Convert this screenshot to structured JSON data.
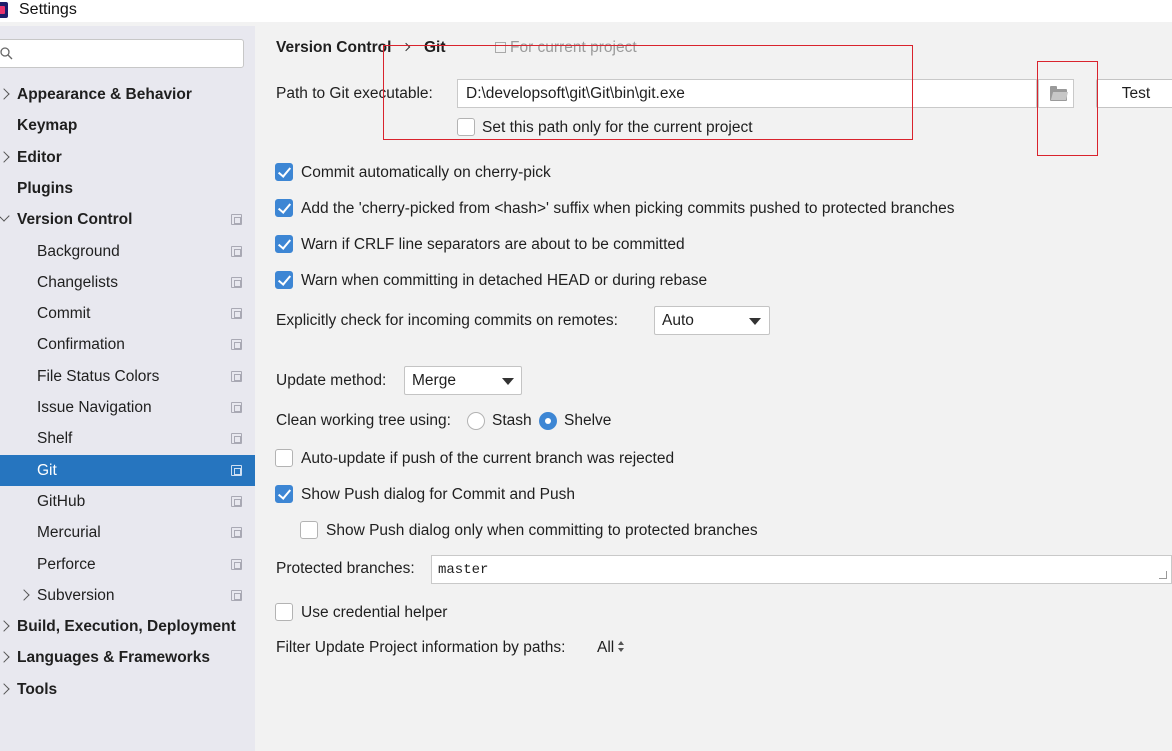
{
  "window": {
    "title": "Settings"
  },
  "sidebar": {
    "search": {
      "placeholder": "",
      "value": ""
    },
    "items": [
      {
        "label": "Appearance & Behavior",
        "bold": true,
        "expander": "right",
        "indent": 0
      },
      {
        "label": "Keymap",
        "bold": true,
        "expander": "none",
        "indent": 0
      },
      {
        "label": "Editor",
        "bold": true,
        "expander": "right",
        "indent": 0
      },
      {
        "label": "Plugins",
        "bold": true,
        "expander": "none",
        "indent": 0
      },
      {
        "label": "Version Control",
        "bold": true,
        "expander": "down",
        "indent": 0,
        "project_icon": true
      },
      {
        "label": "Background",
        "indent": 1,
        "project_icon": true
      },
      {
        "label": "Changelists",
        "indent": 1,
        "project_icon": true
      },
      {
        "label": "Commit",
        "indent": 1,
        "project_icon": true
      },
      {
        "label": "Confirmation",
        "indent": 1,
        "project_icon": true
      },
      {
        "label": "File Status Colors",
        "indent": 1,
        "project_icon": true
      },
      {
        "label": "Issue Navigation",
        "indent": 1,
        "project_icon": true
      },
      {
        "label": "Shelf",
        "indent": 1,
        "project_icon": true
      },
      {
        "label": "Git",
        "indent": 1,
        "project_icon": true,
        "selected": true
      },
      {
        "label": "GitHub",
        "indent": 1,
        "project_icon": true
      },
      {
        "label": "Mercurial",
        "indent": 1,
        "project_icon": true
      },
      {
        "label": "Perforce",
        "indent": 1,
        "project_icon": true
      },
      {
        "label": "Subversion",
        "indent": 1,
        "expander": "right",
        "project_icon": true
      },
      {
        "label": "Build, Execution, Deployment",
        "bold": true,
        "expander": "right",
        "indent": 0
      },
      {
        "label": "Languages & Frameworks",
        "bold": true,
        "expander": "right",
        "indent": 0
      },
      {
        "label": "Tools",
        "bold": true,
        "expander": "right",
        "indent": 0
      }
    ]
  },
  "breadcrumb": {
    "parent": "Version Control",
    "current": "Git",
    "scope": "For current project"
  },
  "git": {
    "path_label": "Path to Git executable:",
    "path_value": "D:\\developsoft\\git\\Git\\bin\\git.exe",
    "test_label": "Test",
    "path_only_current": {
      "label": "Set this path only for the current project",
      "checked": false
    },
    "options": [
      {
        "label": "Commit automatically on cherry-pick",
        "checked": true
      },
      {
        "label": "Add the 'cherry-picked from <hash>' suffix when picking commits pushed to protected branches",
        "checked": true
      },
      {
        "label": "Warn if CRLF line separators are about to be committed",
        "checked": true
      },
      {
        "label": "Warn when committing in detached HEAD or during rebase",
        "checked": true
      }
    ],
    "incoming_label": "Explicitly check for incoming commits on remotes:",
    "incoming_value": "Auto",
    "update_method_label": "Update method:",
    "update_method_value": "Merge",
    "clean_tree_label": "Clean working tree using:",
    "clean_tree_options": [
      {
        "label": "Stash",
        "checked": false
      },
      {
        "label": "Shelve",
        "checked": true
      }
    ],
    "auto_update": {
      "label": "Auto-update if push of the current branch was rejected",
      "checked": false
    },
    "show_push": {
      "label": "Show Push dialog for Commit and Push",
      "checked": true
    },
    "show_push_protected": {
      "label": "Show Push dialog only when committing to protected branches",
      "checked": false
    },
    "protected_label": "Protected branches:",
    "protected_value": "master",
    "credential_helper": {
      "label": "Use credential helper",
      "checked": false
    },
    "filter_label": "Filter Update Project information by paths:",
    "filter_value": "All"
  },
  "colors": {
    "selection": "#2675bf",
    "checkbox": "#3d86d4",
    "annotation": "#d9232d"
  }
}
